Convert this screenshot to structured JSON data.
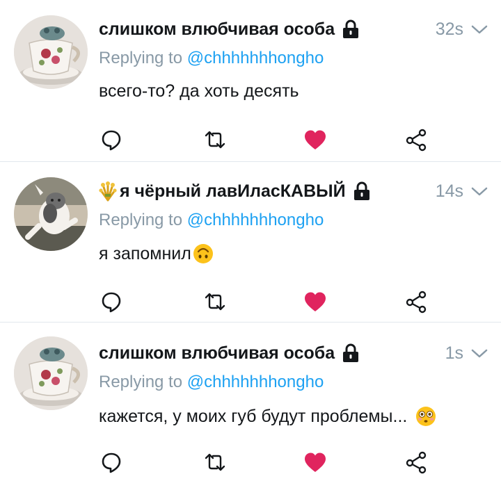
{
  "colors": {
    "text": "#14171a",
    "muted": "#8899a6",
    "link": "#1da1f2",
    "like": "#e0245e",
    "divider": "#e1e8ed"
  },
  "tweets": [
    {
      "name": "слишком влюбчивая особа",
      "prefix_emoji": "",
      "protected_icon": "lock-icon",
      "time": "32s",
      "reply_prefix": "Replying to",
      "reply_handle": "@chhhhhhhongho",
      "text": "всего-то? да хоть десять",
      "text_emoji": ""
    },
    {
      "name": "я чёрный лавИласКАВЫЙ",
      "prefix_emoji": "sheaf-of-rice-emoji",
      "protected_icon": "lock-icon",
      "time": "14s",
      "reply_prefix": "Replying to",
      "reply_handle": "@chhhhhhhongho",
      "text": "я запомнил",
      "text_emoji": "upside-down-face-emoji"
    },
    {
      "name": "слишком влюбчивая особа",
      "prefix_emoji": "",
      "protected_icon": "lock-icon",
      "time": "1s",
      "reply_prefix": "Replying to",
      "reply_handle": "@chhhhhhhongho",
      "text": "кажется, у моих губ будут проблемы...",
      "text_emoji": "flushed-face-emoji"
    }
  ],
  "actions": [
    "reply-icon",
    "retweet-icon",
    "like-icon",
    "share-icon"
  ]
}
